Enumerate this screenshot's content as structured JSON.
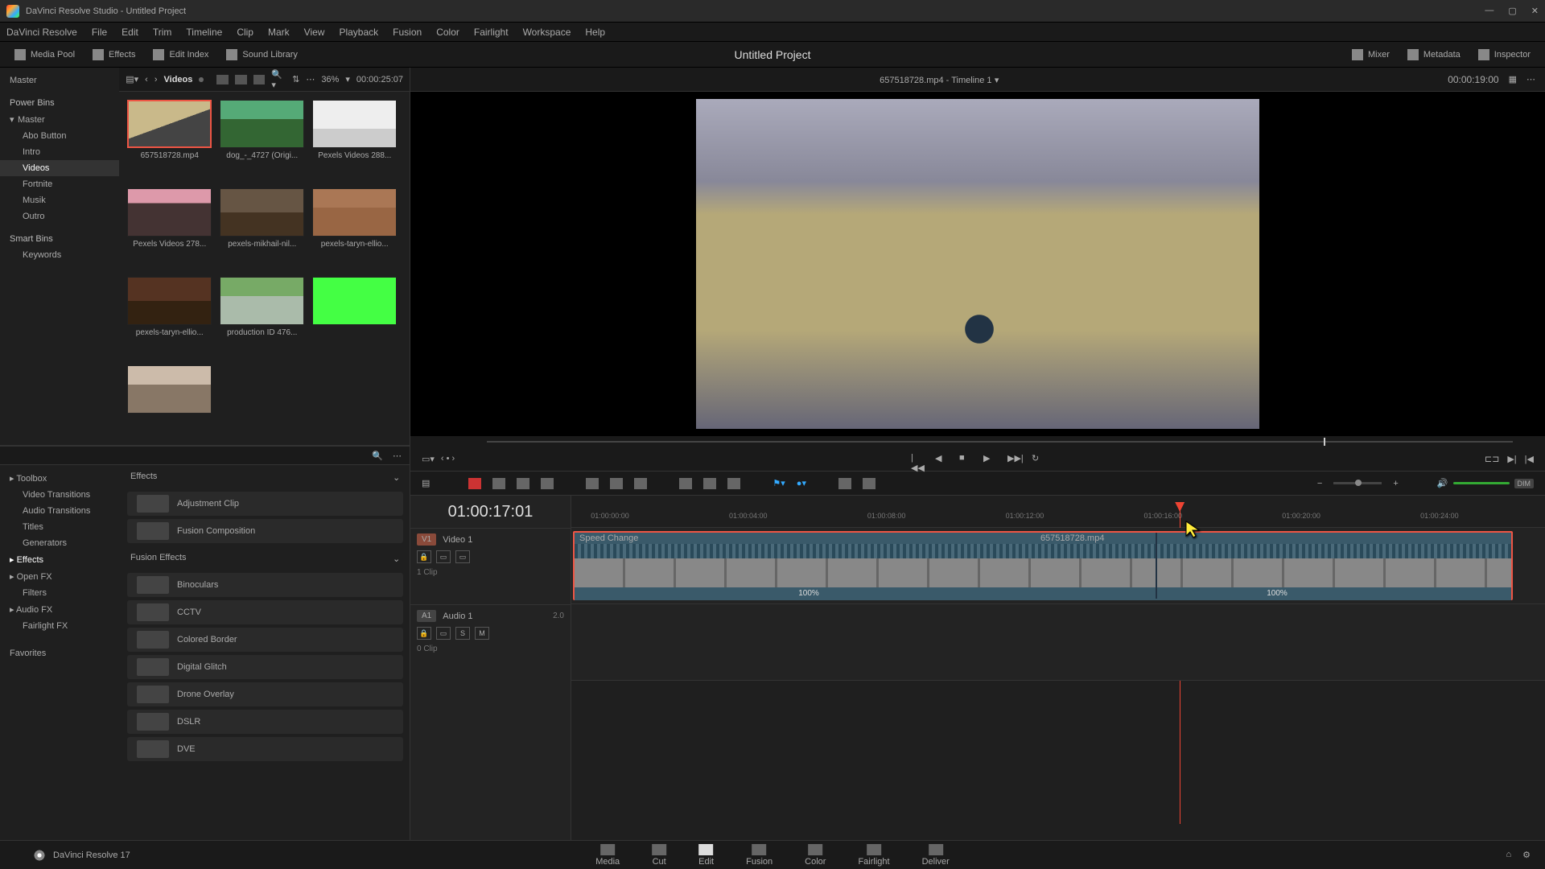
{
  "window": {
    "title": "DaVinci Resolve Studio - Untitled Project"
  },
  "menubar": [
    "DaVinci Resolve",
    "File",
    "Edit",
    "Trim",
    "Timeline",
    "Clip",
    "Mark",
    "View",
    "Playback",
    "Fusion",
    "Color",
    "Fairlight",
    "Workspace",
    "Help"
  ],
  "toolbar": {
    "left": [
      {
        "id": "media-pool",
        "label": "Media Pool",
        "active": true
      },
      {
        "id": "effects",
        "label": "Effects",
        "active": true
      },
      {
        "id": "edit-index",
        "label": "Edit Index",
        "active": false
      },
      {
        "id": "sound-library",
        "label": "Sound Library",
        "active": false
      }
    ],
    "center_title": "Untitled Project",
    "right": [
      {
        "id": "mixer",
        "label": "Mixer"
      },
      {
        "id": "metadata",
        "label": "Metadata"
      },
      {
        "id": "inspector",
        "label": "Inspector"
      }
    ]
  },
  "bins": {
    "top": "Master",
    "power_header": "Power Bins",
    "power": [
      {
        "label": "Master",
        "sub": false,
        "chev": true
      },
      {
        "label": "Abo Button",
        "sub": true
      },
      {
        "label": "Intro",
        "sub": true
      },
      {
        "label": "Videos",
        "sub": true,
        "active": true
      },
      {
        "label": "Fortnite",
        "sub": true
      },
      {
        "label": "Musik",
        "sub": true
      },
      {
        "label": "Outro",
        "sub": true
      }
    ],
    "smart_header": "Smart Bins",
    "smart": [
      {
        "label": "Keywords",
        "sub": true
      }
    ]
  },
  "pool": {
    "crumb": "Videos",
    "zoom": "36%",
    "duration": "00:00:25:07",
    "timeline_title": "657518728.mp4 - Timeline 1",
    "timeline_tc": "00:00:19:00",
    "clips": [
      {
        "name": "657518728.mp4",
        "t": "t1",
        "selected": true
      },
      {
        "name": "dog_-_4727 (Origi...",
        "t": "t2"
      },
      {
        "name": "Pexels Videos 288...",
        "t": "t3"
      },
      {
        "name": "Pexels Videos 278...",
        "t": "t4"
      },
      {
        "name": "pexels-mikhail-nil...",
        "t": "t5"
      },
      {
        "name": "pexels-taryn-ellio...",
        "t": "t6"
      },
      {
        "name": "pexels-taryn-ellio...",
        "t": "t7"
      },
      {
        "name": "production ID 476...",
        "t": "t8"
      },
      {
        "name": "",
        "t": "t9"
      },
      {
        "name": "",
        "t": "t10"
      }
    ]
  },
  "fxtree": [
    {
      "label": "Toolbox",
      "chev": true
    },
    {
      "label": "Video Transitions",
      "sub": true
    },
    {
      "label": "Audio Transitions",
      "sub": true
    },
    {
      "label": "Titles",
      "sub": true
    },
    {
      "label": "Generators",
      "sub": true
    },
    {
      "label": "Effects",
      "chev": true,
      "active": true
    },
    {
      "label": "Open FX",
      "chev": true
    },
    {
      "label": "Filters",
      "sub": true
    },
    {
      "label": "Audio FX",
      "chev": true
    },
    {
      "label": "Fairlight FX",
      "sub": true
    }
  ],
  "favorites_header": "Favorites",
  "fxlist": {
    "sec1": "Effects",
    "items1": [
      "Adjustment Clip",
      "Fusion Composition"
    ],
    "sec2": "Fusion Effects",
    "items2": [
      "Binoculars",
      "CCTV",
      "Colored Border",
      "Digital Glitch",
      "Drone Overlay",
      "DSLR",
      "DVE"
    ]
  },
  "timeline": {
    "bigtc": "01:00:17:01",
    "ruler": [
      "01:00:00:00",
      "01:00:04:00",
      "01:00:08:00",
      "01:00:12:00",
      "01:00:16:00",
      "01:00:20:00",
      "01:00:24:00"
    ],
    "playhead_pct": 62,
    "v1": {
      "badge": "V1",
      "name": "Video 1",
      "meta": "1 Clip"
    },
    "a1": {
      "badge": "A1",
      "name": "Audio 1",
      "ch": "2.0",
      "meta": "0 Clip",
      "btns": [
        "S",
        "M"
      ]
    },
    "clip": {
      "label": "Speed Change",
      "name": "657518728.mp4",
      "split_pct": 62,
      "speeds": [
        "100%",
        "100%"
      ]
    }
  },
  "bottombar": {
    "app": "DaVinci Resolve 17",
    "pages": [
      {
        "id": "media",
        "label": "Media"
      },
      {
        "id": "cut",
        "label": "Cut"
      },
      {
        "id": "edit",
        "label": "Edit",
        "active": true
      },
      {
        "id": "fusion",
        "label": "Fusion"
      },
      {
        "id": "color",
        "label": "Color"
      },
      {
        "id": "fairlight",
        "label": "Fairlight"
      },
      {
        "id": "deliver",
        "label": "Deliver"
      }
    ]
  },
  "dim_label": "DIM"
}
